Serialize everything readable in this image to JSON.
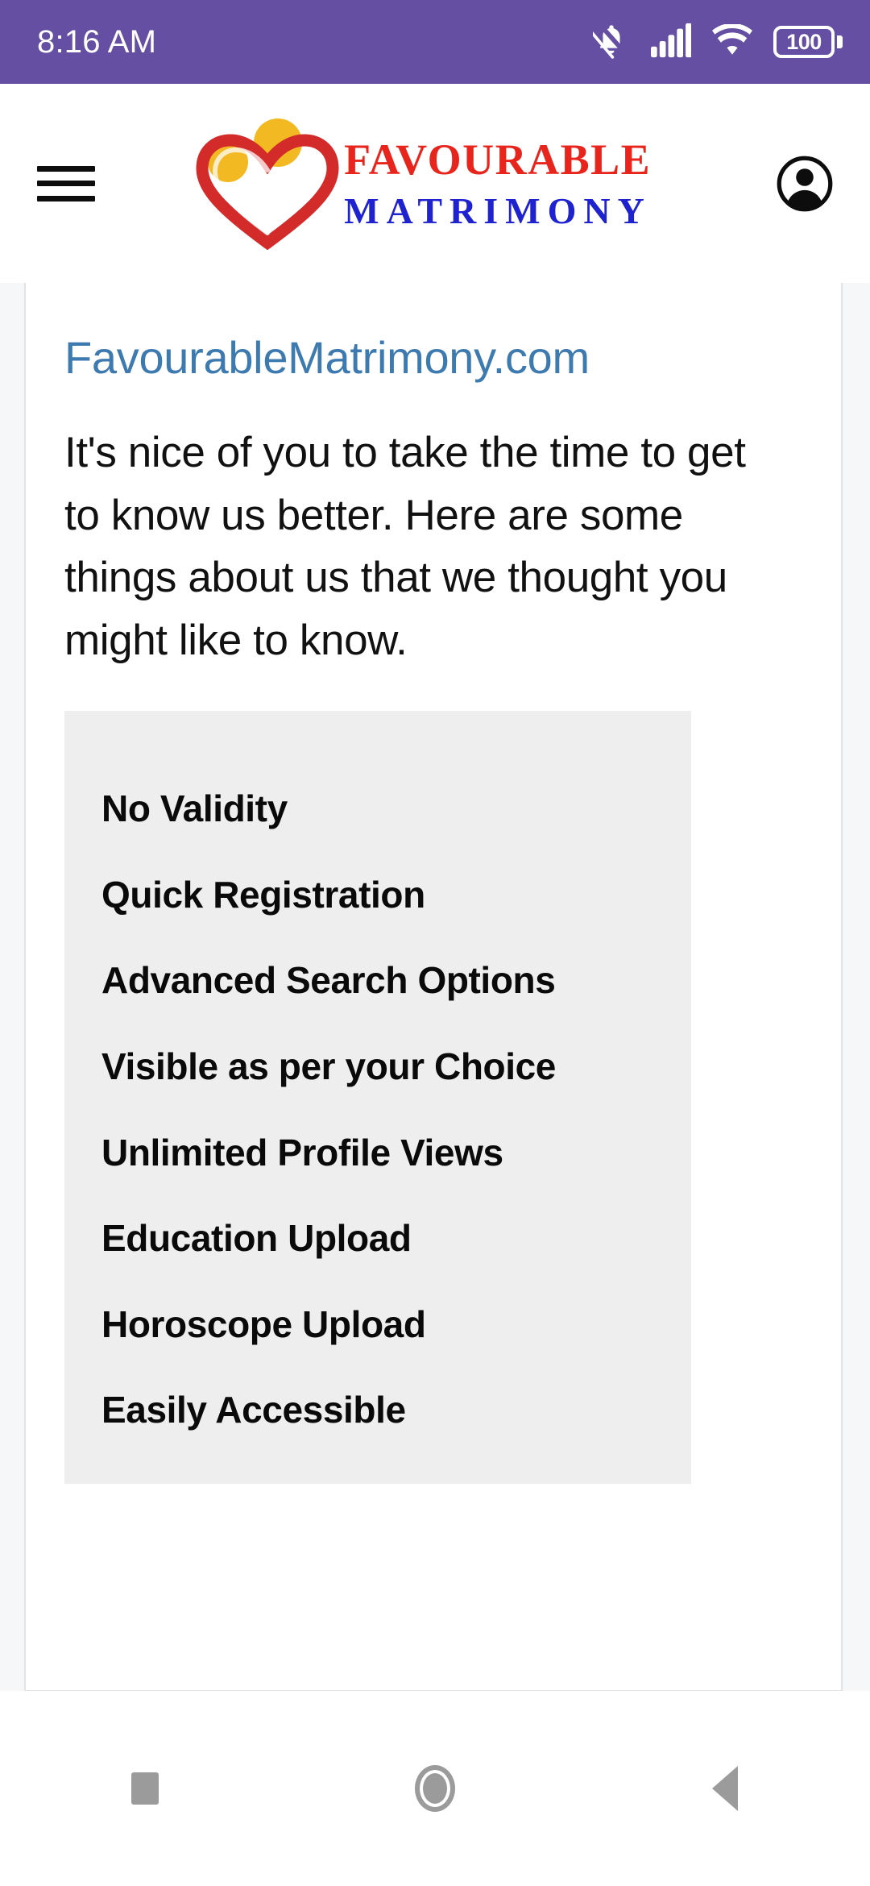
{
  "status_bar": {
    "time": "8:16 AM",
    "background_color": "#644fa3",
    "battery_level": "100",
    "icons": [
      "notifications-off-icon",
      "cellular-signal-icon",
      "wifi-icon",
      "battery-icon"
    ]
  },
  "app_header": {
    "menu_icon": "hamburger-menu-icon",
    "account_icon": "account-circle-icon",
    "logo": {
      "line1": "FAVOURABLE",
      "line2": "MATRIMONY",
      "line1_color": "#e8251c",
      "line2_color": "#1f23cf",
      "heart_color": "#d32a2a",
      "dot_color": "#f2b923"
    }
  },
  "content": {
    "site_link": "FavourableMatrimony.com",
    "site_link_color": "#3d7ab0",
    "intro_text": "It's nice of you to take the time to get to know us better. Here are some things about us that we thought you might like to know.",
    "features_background": "#eeeeee",
    "features": [
      "No Validity",
      "Quick Registration",
      "Advanced Search Options",
      "Visible as per your Choice",
      "Unlimited Profile Views",
      "Education Upload",
      "Horoscope Upload",
      "Easily Accessible"
    ]
  },
  "navigation_bar": {
    "recents_label": "recents-square-icon",
    "home_label": "home-circle-icon",
    "back_label": "back-triangle-icon",
    "icon_color": "#9b9b9b"
  }
}
